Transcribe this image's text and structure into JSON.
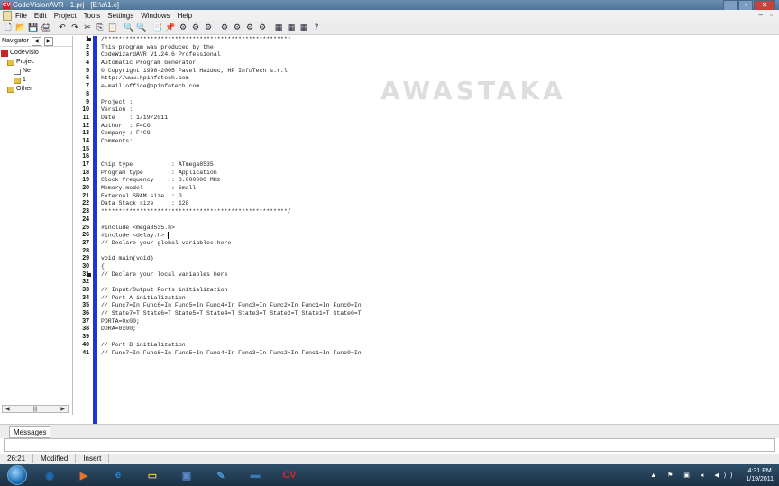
{
  "window": {
    "title": "CodeVisionAVR - 1.prj - [E:\\a\\1.c]",
    "app_icon_label": "CV",
    "min_label": "–",
    "max_label": "▫",
    "close_label": "✕"
  },
  "menu": {
    "items": [
      "File",
      "Edit",
      "Project",
      "Tools",
      "Settings",
      "Windows",
      "Help"
    ],
    "mdi_buttons": "–  ▫"
  },
  "toolbar": {
    "buttons": [
      "🗋",
      "📂",
      "💾",
      "🖨",
      "↶",
      "↷",
      "✂",
      "⎘",
      "📋",
      "🔍",
      "🔍",
      "📑",
      "📌",
      "⚙",
      "⚙",
      "⚙",
      "⚙",
      "⚙",
      "⚙",
      "⚙",
      "▦",
      "▦",
      "▦",
      "?"
    ]
  },
  "navigator": {
    "title": "Navigator",
    "arrows": [
      "◀",
      "▶"
    ],
    "tree": [
      "CodeVisio",
      "Projec",
      "Ne",
      "1",
      "Other"
    ],
    "hscroll": [
      "◀",
      "|||",
      "▶"
    ]
  },
  "editor": {
    "line_numbers": [
      "1",
      "2",
      "3",
      "4",
      "5",
      "6",
      "7",
      "8",
      "9",
      "10",
      "11",
      "12",
      "13",
      "14",
      "15",
      "16",
      "17",
      "18",
      "19",
      "20",
      "21",
      "22",
      "23",
      "24",
      "25",
      "26",
      "27",
      "28",
      "29",
      "30",
      "31",
      "32",
      "33",
      "34",
      "35",
      "36",
      "37",
      "38",
      "39",
      "40",
      "41"
    ],
    "lines": [
      "/*****************************************************",
      "This program was produced by the",
      "CodeWizardAVR V1.24.6 Professional",
      "Automatic Program Generator",
      "© Copyright 1998-2005 Pavel Haiduc, HP InfoTech s.r.l.",
      "http://www.hpinfotech.com",
      "e-mail:office@hpinfotech.com",
      "",
      "Project :",
      "Version :",
      "Date    : 1/19/2011",
      "Author  : F4CG",
      "Company : F4CG",
      "Comments:",
      "",
      "",
      "Chip type           : ATmega8535",
      "Program type        : Application",
      "Clock frequency     : 8.000000 MHz",
      "Memory model        : Small",
      "External SRAM size  : 0",
      "Data Stack size     : 128",
      "*****************************************************/",
      "",
      "#include <mega8535.h>",
      "#include <delay.h>",
      "// Declare your global variables here",
      "",
      "void main(void)",
      "{",
      "// Declare your local variables here",
      "",
      "// Input/Output Ports initialization",
      "// Port A initialization",
      "// Func7=In Func6=In Func5=In Func4=In Func3=In Func2=In Func1=In Func0=In",
      "// State7=T State6=T State5=T State4=T State3=T State2=T State1=T State0=T",
      "PORTA=0x00;",
      "DDRA=0x00;",
      "",
      "// Port B initialization",
      "// Func7=In Func6=In Func5=In Func4=In Func3=In Func2=In Func1=In Func0=In"
    ]
  },
  "watermark": "AWASTAKA",
  "messages": {
    "tab": "Messages"
  },
  "status": {
    "position": "26:21",
    "modified": "Modified",
    "mode": "Insert"
  },
  "taskbar": {
    "apps": [
      {
        "label": "◉",
        "color": "#1c6fb8"
      },
      {
        "label": "▶",
        "color": "#e8732a"
      },
      {
        "label": "e",
        "color": "#2a7fd0"
      },
      {
        "label": "▭",
        "color": "#e6c248"
      },
      {
        "label": "▣",
        "color": "#5a86c8"
      },
      {
        "label": "✎",
        "color": "#4d97d6"
      },
      {
        "label": "▬",
        "color": "#3a78b5"
      },
      {
        "label": "CV",
        "color": "#d02a2a"
      }
    ],
    "tray_icons": "▲ ⚑ ▣ ◂ ◀))",
    "time": "4:31 PM",
    "date": "1/19/2011"
  }
}
